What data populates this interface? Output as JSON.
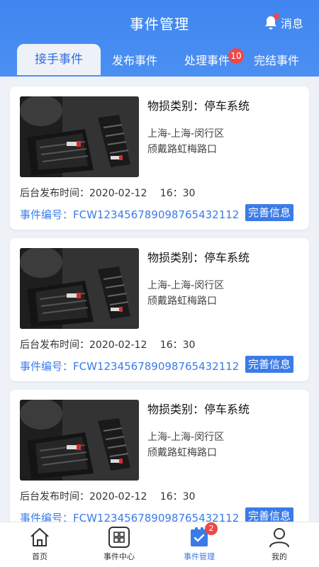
{
  "header": {
    "title": "事件管理",
    "message_label": "消息"
  },
  "tabs": [
    {
      "label": "接手事件"
    },
    {
      "label": "发布事件"
    },
    {
      "label": "处理事件",
      "badge": "10"
    },
    {
      "label": "完结事件"
    }
  ],
  "events": [
    {
      "category": "物损类别：停车系统",
      "address_line1": "上海-上海-闵行区",
      "address_line2": "颀戴路虹梅路口",
      "publish_time": "后台发布时间：2020-02-12　 16：30",
      "event_code": "事件编号：FCW123456789098765432112",
      "action_label": "完善信息"
    },
    {
      "category": "物损类别：停车系统",
      "address_line1": "上海-上海-闵行区",
      "address_line2": "颀戴路虹梅路口",
      "publish_time": "后台发布时间：2020-02-12　 16：30",
      "event_code": "事件编号：FCW123456789098765432112",
      "action_label": "完善信息"
    },
    {
      "category": "物损类别：停车系统",
      "address_line1": "上海-上海-闵行区",
      "address_line2": "颀戴路虹梅路口",
      "publish_time": "后台发布时间：2020-02-12　 16：30",
      "event_code": "事件编号：FCW123456789098765432112",
      "action_label": "完善信息"
    }
  ],
  "tabbar": [
    {
      "label": "首页",
      "icon": "home-icon"
    },
    {
      "label": "事件中心",
      "icon": "grid-icon"
    },
    {
      "label": "事件管理",
      "icon": "checklist-icon",
      "badge": "2"
    },
    {
      "label": "我的",
      "icon": "user-icon"
    }
  ],
  "colors": {
    "primary": "#3a7be8",
    "badge": "#ef4848",
    "background": "#eef2f8"
  }
}
